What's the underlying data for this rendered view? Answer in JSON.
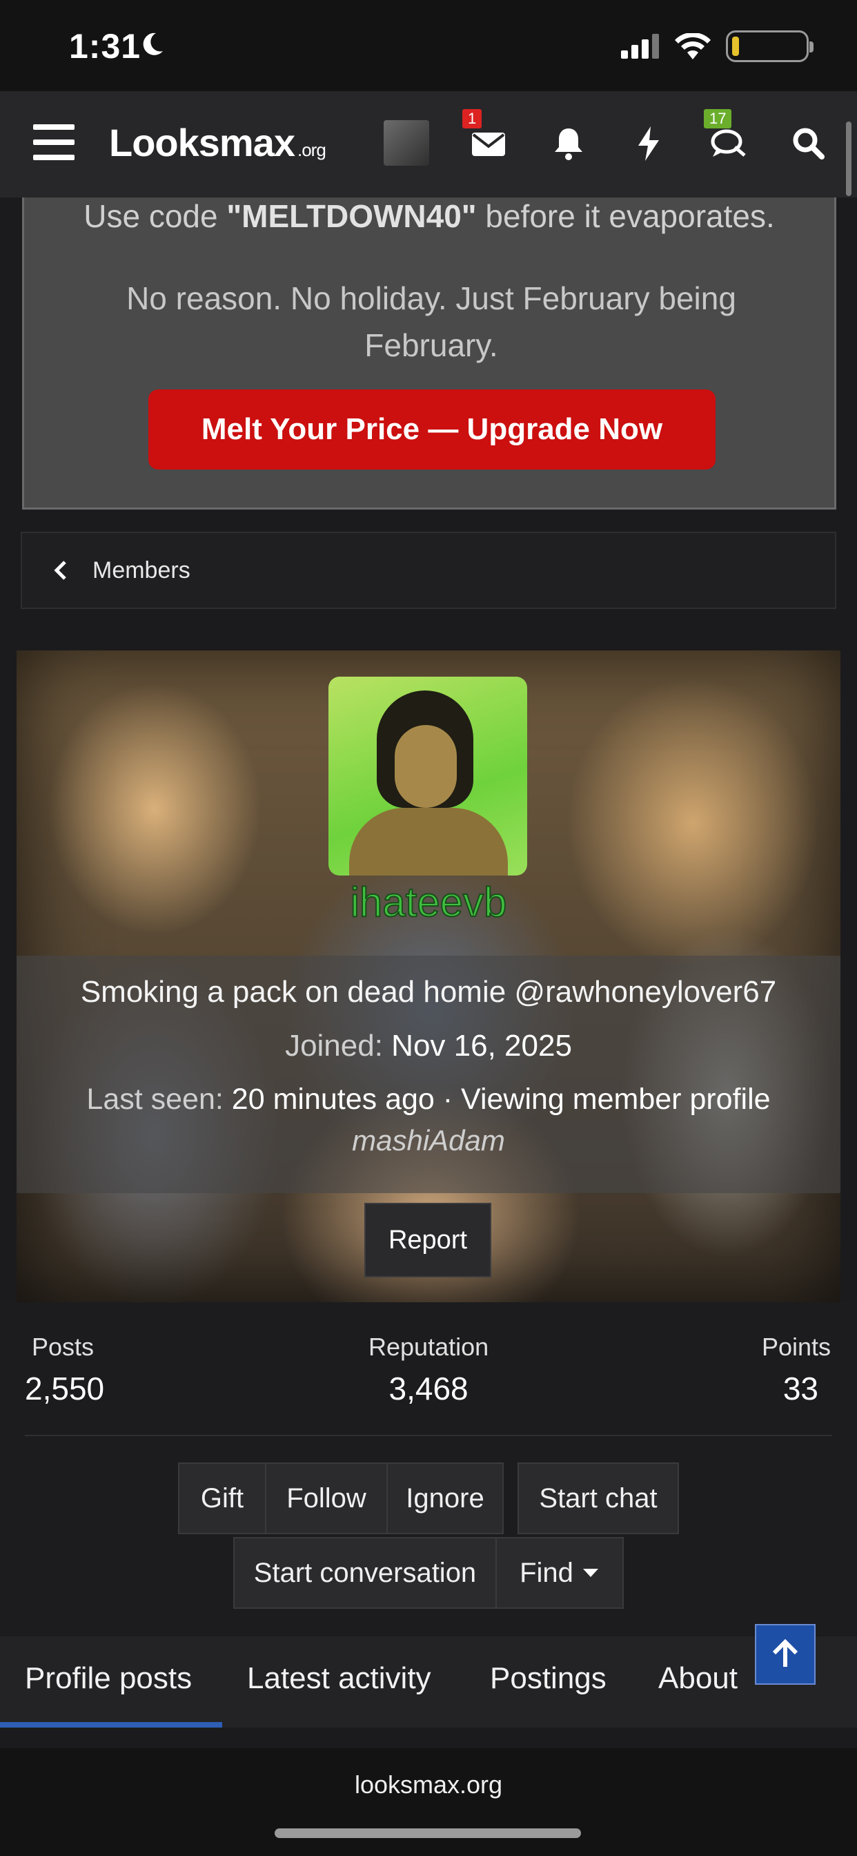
{
  "status_bar": {
    "time": "1:31"
  },
  "nav": {
    "logo": "Looksmax",
    "logo_suffix": ".org",
    "inbox_badge": "1",
    "chat_badge": "17"
  },
  "promo": {
    "code_prefix": "Use code ",
    "code": "\"MELTDOWN40\"",
    "code_suffix": " before it evaporates.",
    "subtext": "No reason. No holiday. Just February being February.",
    "cta_label": "Melt Your Price — Upgrade Now"
  },
  "breadcrumb": {
    "label": "Members"
  },
  "profile": {
    "username": "ihateevb",
    "status_message": "Smoking a pack on dead homie @rawhoneylover67",
    "joined_label": "Joined: ",
    "joined_value": "Nov 16, 2025",
    "last_seen_label": "Last seen: ",
    "last_seen_value": "20 minutes ago · Viewing member profile",
    "custom_title": "mashiAdam",
    "report_label": "Report"
  },
  "stats": [
    {
      "label": "Posts",
      "value": "2,550"
    },
    {
      "label": "Reputation",
      "value": "3,468"
    },
    {
      "label": "Points",
      "value": "33"
    }
  ],
  "actions": {
    "gift": "Gift",
    "follow": "Follow",
    "ignore": "Ignore",
    "start_chat": "Start chat",
    "start_conversation": "Start conversation",
    "find": "Find"
  },
  "tabs": [
    "Profile posts",
    "Latest activity",
    "Postings",
    "About"
  ],
  "browser": {
    "url": "looksmax.org"
  },
  "colors": {
    "accent": "#2e5fb5",
    "cta": "#cc0f0f",
    "username": "#3fbf3f"
  }
}
